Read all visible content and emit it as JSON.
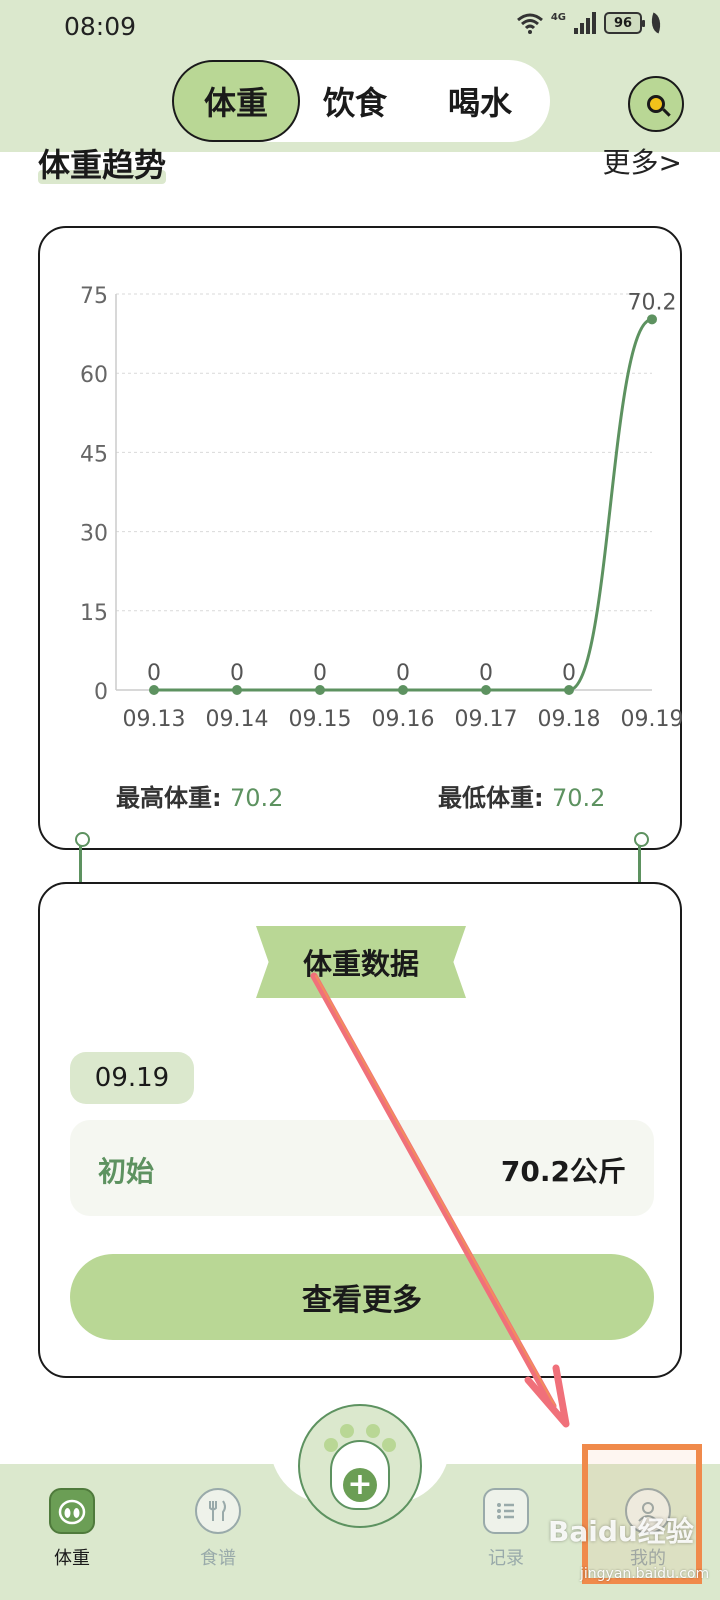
{
  "status_bar": {
    "time": "08:09",
    "network": "4G",
    "battery": "96"
  },
  "top_tabs": [
    {
      "label": "体重",
      "active": true
    },
    {
      "label": "饮食",
      "active": false
    },
    {
      "label": "喝水",
      "active": false
    }
  ],
  "section": {
    "title": "体重趋势",
    "more": "更多>"
  },
  "chart_data": {
    "type": "line",
    "categories": [
      "09.13",
      "09.14",
      "09.15",
      "09.16",
      "09.17",
      "09.18",
      "09.19"
    ],
    "series": [
      {
        "values": [
          0,
          0,
          0,
          0,
          0,
          0,
          70.2
        ]
      }
    ],
    "data_labels": [
      "0",
      "0",
      "0",
      "0",
      "0",
      "0",
      "70.2"
    ],
    "yticks": [
      0,
      15,
      30,
      45,
      60,
      75
    ],
    "ylim": [
      0,
      75
    ],
    "grid": true,
    "line_color": "#5d9260",
    "title": "",
    "xlabel": "",
    "ylabel": ""
  },
  "summary": {
    "max_label": "最高体重:",
    "max_value": "70.2",
    "min_label": "最低体重:",
    "min_value": "70.2"
  },
  "data_card": {
    "ribbon": "体重数据",
    "date": "09.19",
    "record_label": "初始",
    "record_value": "70.2公斤",
    "button": "查看更多"
  },
  "bottom_nav": [
    {
      "label": "体重",
      "icon": "scale-icon",
      "active": true
    },
    {
      "label": "食谱",
      "icon": "fork-knife-icon",
      "active": false
    },
    {
      "label": "",
      "icon": "paw-add-icon",
      "active": false
    },
    {
      "label": "记录",
      "icon": "list-icon",
      "active": false
    },
    {
      "label": "我的",
      "icon": "user-icon",
      "active": false
    }
  ],
  "watermark": {
    "text": "Baidu经验",
    "sub": "jingyan.baidu.com"
  },
  "colors": {
    "accent": "#b9d795",
    "header_bg": "#dbe8cd",
    "series": "#5d9260",
    "annotation": "#f08a4b"
  }
}
